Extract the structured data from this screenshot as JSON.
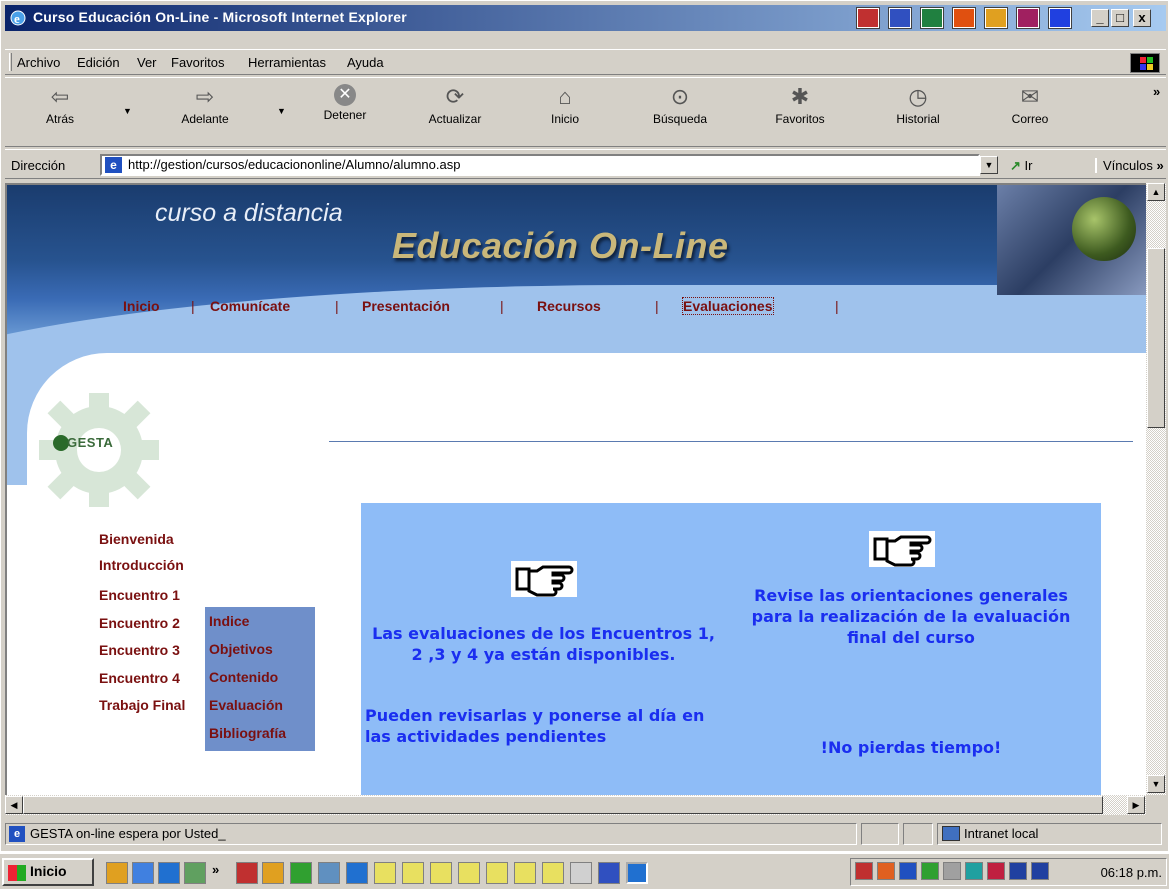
{
  "window": {
    "title": "Curso Educación On-Line - Microsoft Internet Explorer",
    "controls": {
      "minimize": "_",
      "maximize": "□",
      "close": "x"
    }
  },
  "menubar": {
    "items": [
      "Archivo",
      "Edición",
      "Ver",
      "Favoritos",
      "Herramientas",
      "Ayuda"
    ]
  },
  "toolbar": {
    "buttons": [
      {
        "label": "Atrás",
        "icon": "back-arrow-icon"
      },
      {
        "label": "Adelante",
        "icon": "forward-arrow-icon"
      },
      {
        "label": "Detener",
        "icon": "stop-icon"
      },
      {
        "label": "Actualizar",
        "icon": "refresh-icon"
      },
      {
        "label": "Inicio",
        "icon": "home-icon"
      },
      {
        "label": "Búsqueda",
        "icon": "search-icon"
      },
      {
        "label": "Favoritos",
        "icon": "favorites-icon"
      },
      {
        "label": "Historial",
        "icon": "history-icon"
      },
      {
        "label": "Correo",
        "icon": "mail-icon"
      }
    ],
    "more": "»"
  },
  "addressbar": {
    "label": "Dirección",
    "url": "http://gestion/cursos/educaciononline/Alumno/alumno.asp",
    "go_label": "Ir",
    "links_label": "Vínculos"
  },
  "page": {
    "subtitle": "curso a distancia",
    "title": "Educación On-Line",
    "nav": [
      "Inicio",
      "Comunícate",
      "Presentación",
      "Recursos",
      "Evaluaciones"
    ],
    "nav_separator": "|",
    "logo_text": "GESTA",
    "sidebar": [
      "Bienvenida",
      "Introducción",
      "Encuentro 1",
      "Encuentro 2",
      "Encuentro 3",
      "Encuentro 4",
      "Trabajo Final"
    ],
    "submenu": [
      "Indice",
      "Objetivos",
      "Contenido",
      "Evaluación",
      "Bibliografía"
    ],
    "box": {
      "left_text": "Las evaluaciones de los Encuentros 1, 2 ,3 y 4 ya están disponibles.",
      "left_text2": "Pueden revisarlas y ponerse al día en las actividades pendientes",
      "right_text": "Revise las orientaciones generales para la realización de la evaluación final del curso",
      "right_text2": "!No pierdas tiempo!"
    }
  },
  "statusbar": {
    "message": "GESTA on-line espera por Usted_",
    "zone": "Intranet local"
  },
  "taskbar": {
    "start_label": "Inicio",
    "clock": "06:18 p.m."
  },
  "colors": {
    "nav_link": "#7a1010",
    "box_bg": "#8ebcf7",
    "box_text": "#1a2ef0",
    "title_gold": "#c9b77a"
  }
}
